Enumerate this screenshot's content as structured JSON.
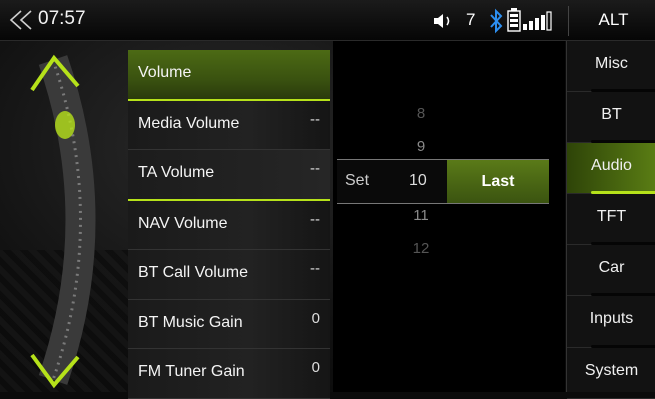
{
  "status": {
    "time": "07:57",
    "volume": "7",
    "alt_label": "ALT"
  },
  "menu": [
    {
      "label": "Volume",
      "value": ""
    },
    {
      "label": "Media Volume",
      "value": "--"
    },
    {
      "label": "TA Volume",
      "value": "--"
    },
    {
      "label": "NAV Volume",
      "value": "--"
    },
    {
      "label": "BT Call Volume",
      "value": "--"
    },
    {
      "label": "BT Music Gain",
      "value": "0"
    },
    {
      "label": "FM Tuner Gain",
      "value": "0"
    }
  ],
  "picker": {
    "numbers_above": [
      "8",
      "9"
    ],
    "current": "10",
    "numbers_below": [
      "11",
      "12"
    ],
    "set_label": "Set",
    "last_label": "Last"
  },
  "tabs": [
    {
      "label": "Misc"
    },
    {
      "label": "BT"
    },
    {
      "label": "Audio"
    },
    {
      "label": "TFT"
    },
    {
      "label": "Car"
    },
    {
      "label": "Inputs"
    },
    {
      "label": "System"
    }
  ],
  "colors": {
    "accent": "#b6e21a",
    "selected": "#3a5210"
  }
}
